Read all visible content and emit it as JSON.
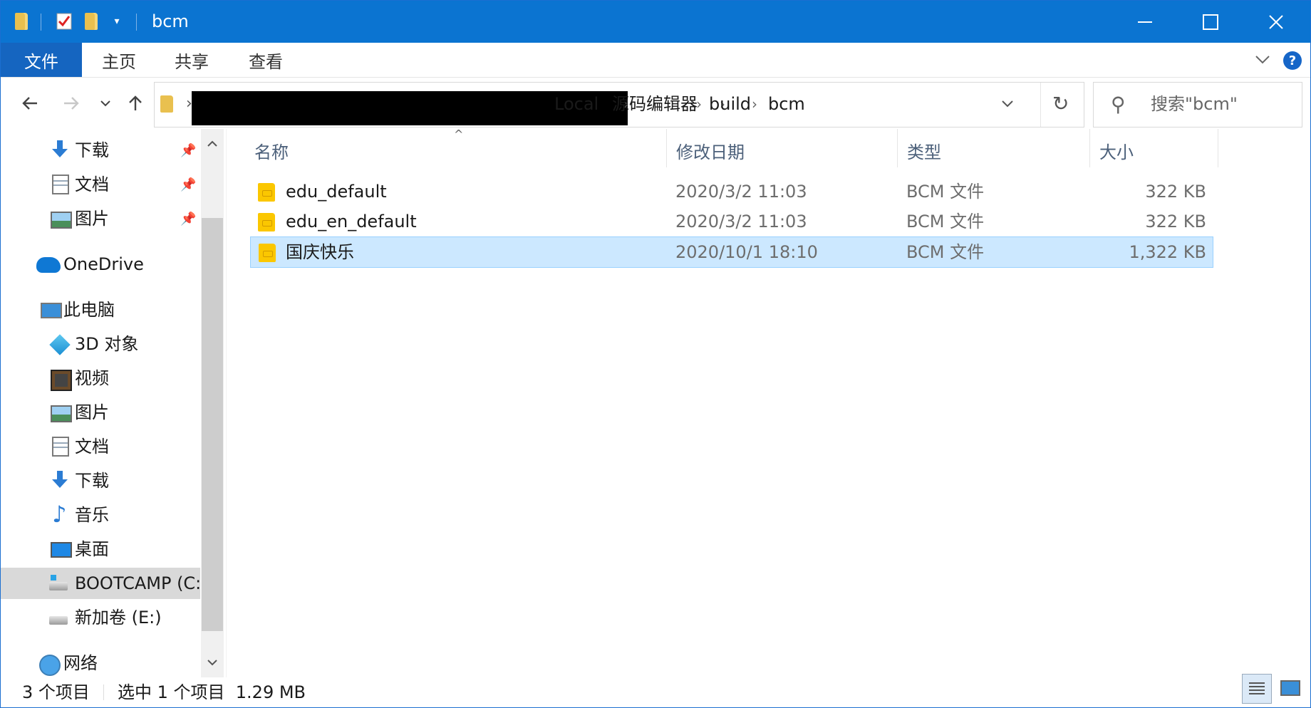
{
  "window": {
    "title": "bcm"
  },
  "ribbon": {
    "tabs": [
      "文件",
      "主页",
      "共享",
      "查看"
    ],
    "help": "?"
  },
  "address": {
    "crumbs": [
      "Local",
      "源码编辑器",
      "build",
      "bcm"
    ]
  },
  "search": {
    "placeholder": "搜索\"bcm\""
  },
  "nav": {
    "items": [
      {
        "label": "下载",
        "icon": "download-icon"
      },
      {
        "label": "文档",
        "icon": "document-icon"
      },
      {
        "label": "图片",
        "icon": "pictures-icon"
      },
      {
        "label": "OneDrive",
        "icon": "onedrive-icon"
      },
      {
        "label": "此电脑",
        "icon": "this-pc-icon"
      },
      {
        "label": "3D 对象",
        "icon": "3d-objects-icon"
      },
      {
        "label": "视频",
        "icon": "videos-icon"
      },
      {
        "label": "图片",
        "icon": "pictures-icon"
      },
      {
        "label": "文档",
        "icon": "document-icon"
      },
      {
        "label": "下载",
        "icon": "download-icon"
      },
      {
        "label": "音乐",
        "icon": "music-icon"
      },
      {
        "label": "桌面",
        "icon": "desktop-icon"
      },
      {
        "label": "BOOTCAMP (C:",
        "icon": "windows-drive-icon"
      },
      {
        "label": "新加卷 (E:)",
        "icon": "drive-icon"
      },
      {
        "label": "网络",
        "icon": "network-icon"
      }
    ]
  },
  "columns": {
    "name": "名称",
    "date": "修改日期",
    "type": "类型",
    "size": "大小"
  },
  "files": [
    {
      "name": "edu_default",
      "date": "2020/3/2 11:03",
      "type": "BCM 文件",
      "size": "322 KB"
    },
    {
      "name": "edu_en_default",
      "date": "2020/3/2 11:03",
      "type": "BCM 文件",
      "size": "322 KB"
    },
    {
      "name": "国庆快乐",
      "date": "2020/10/1 18:10",
      "type": "BCM 文件",
      "size": "1,322 KB"
    }
  ],
  "status": {
    "count": "3 个项目",
    "selection": "选中 1 个项目  1.29 MB"
  },
  "colors": {
    "titlebar": "#0b74d1",
    "selection": "#cce8ff",
    "file_tab": "#1565c0"
  }
}
